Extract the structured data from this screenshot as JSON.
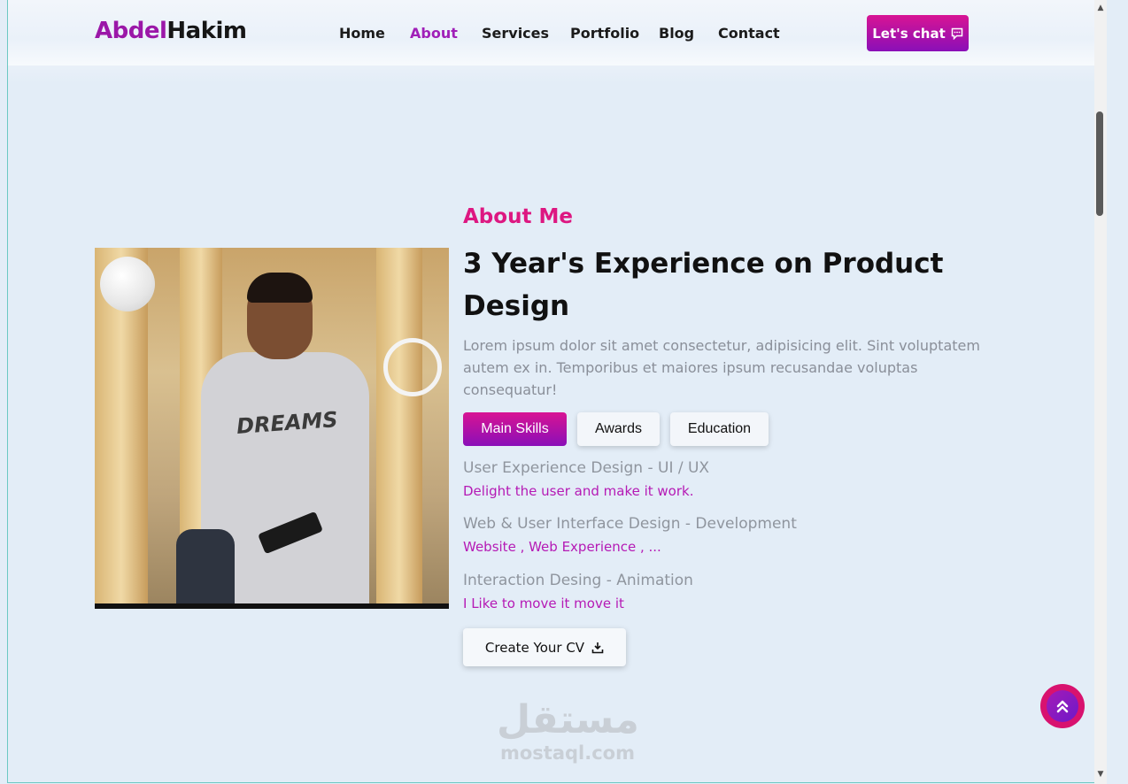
{
  "logo": {
    "first": "Abdel",
    "second": "Hakim"
  },
  "nav": {
    "items": [
      "Home",
      "About",
      "Services",
      "Portfolio",
      "Blog",
      "Contact"
    ],
    "active": "About"
  },
  "chat_button": {
    "label": "Let's chat"
  },
  "about": {
    "kicker": "About Me",
    "title": "3 Year's Experience on Product Design",
    "description": "Lorem ipsum dolor sit amet consectetur, adipisicing elit. Sint voluptatem autem ex in. Temporibus et maiores ipsum recusandae voluptas consequatur!",
    "tabs": [
      "Main Skills",
      "Awards",
      "Education"
    ],
    "active_tab": "Main Skills",
    "skills": [
      {
        "title": "User Experience Design - UI / UX",
        "subtitle": "Delight the user and make it work."
      },
      {
        "title": "Web & User Interface Design - Development",
        "subtitle": "Website , Web Experience , ..."
      },
      {
        "title": "Interaction Desing - Animation",
        "subtitle": "I Like to move it move it"
      }
    ],
    "cv_button": "Create Your CV"
  },
  "photo": {
    "shirt_text": "DREAMS"
  },
  "watermark": {
    "arabic": "مستقل",
    "latin": "mostaql.com"
  },
  "colors": {
    "accent": "#dd1781",
    "purple": "#9b17a8",
    "background": "#e3edf7"
  },
  "icons": {
    "chat": "chat-bubble-icon",
    "download": "download-icon",
    "back_to_top": "double-chevron-up-icon"
  }
}
